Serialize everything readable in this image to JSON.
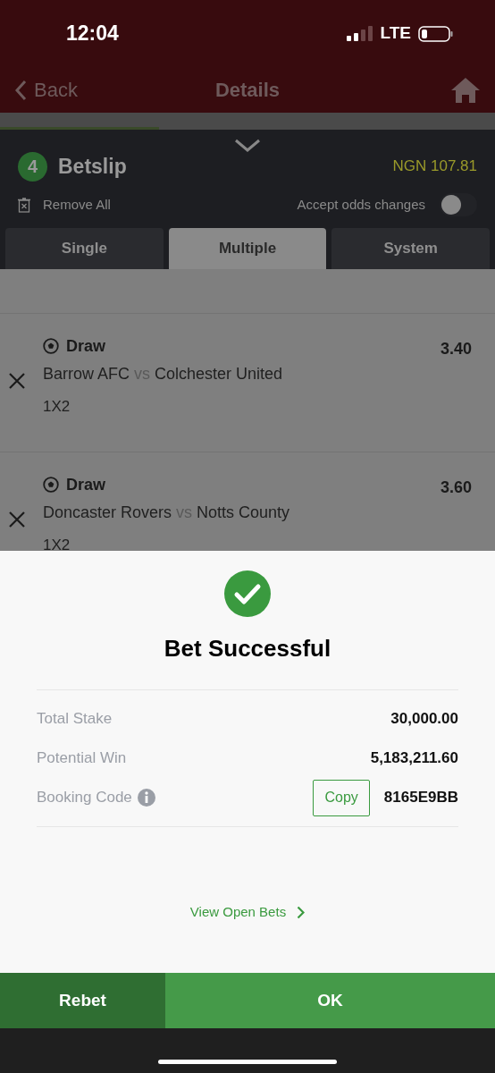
{
  "status_bar": {
    "time": "12:04",
    "network": "LTE"
  },
  "nav": {
    "back": "Back",
    "title": "Details"
  },
  "betslip": {
    "count": "4",
    "title": "Betslip",
    "balance": "NGN 107.81",
    "remove_all": "Remove All",
    "accept_odds": {
      "label": "Accept odds changes",
      "on": false
    }
  },
  "tabs": [
    {
      "label": "Single",
      "selected": false
    },
    {
      "label": "Multiple",
      "selected": true
    },
    {
      "label": "System",
      "selected": false
    }
  ],
  "selections": [
    {
      "pick": "Draw",
      "home": "Barrow AFC",
      "vs": "vs",
      "away": "Colchester United",
      "market": "1X2",
      "odds": "3.40"
    },
    {
      "pick": "Draw",
      "home": "Doncaster Rovers",
      "vs": "vs",
      "away": "Notts County",
      "market": "1X2",
      "odds": "3.60"
    }
  ],
  "success": {
    "title": "Bet Successful",
    "rows": [
      {
        "kind": "text",
        "label": "Total Stake",
        "value": "30,000.00"
      },
      {
        "kind": "text",
        "label": "Potential Win",
        "value": "5,183,211.60"
      },
      {
        "kind": "code",
        "label": "Booking Code",
        "action": "Copy",
        "value": "8165E9BB"
      }
    ],
    "link": "View Open Bets"
  },
  "buttons": {
    "rebet": "Rebet",
    "ok": "OK"
  }
}
